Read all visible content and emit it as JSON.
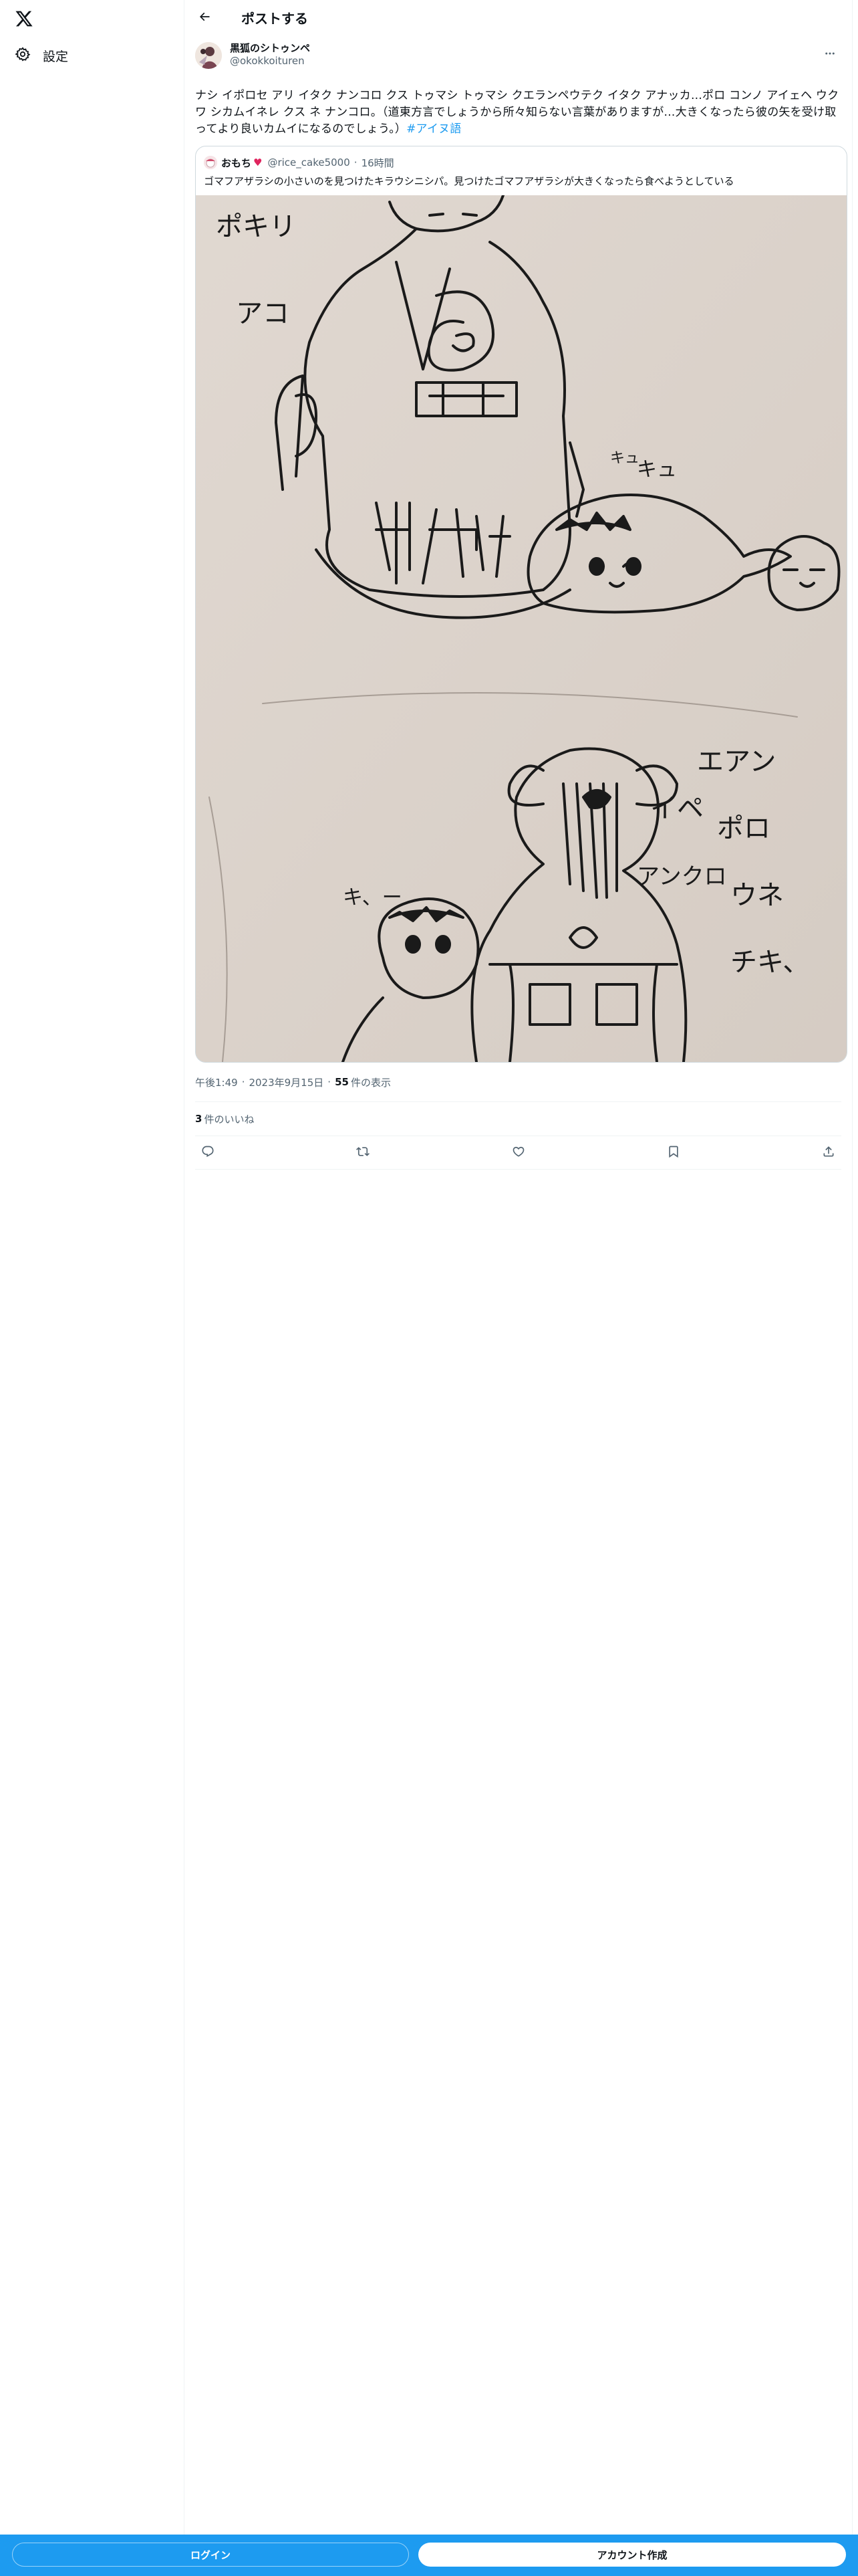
{
  "nav": {
    "logo_icon": "x-logo-icon",
    "settings_label": "設定",
    "settings_icon": "gear-icon"
  },
  "header": {
    "title": "ポストする",
    "back_icon": "arrow-left-icon"
  },
  "post": {
    "author_display_name": "黒狐のシトゥンペ",
    "author_handle": "@okokkoituren",
    "text": "ナシ イポロセ アリ イタク ナンコロ クス トゥマシ トゥマシ クエランペウテク イタク アナッカ…ポロ コンノ アイェヘ ウク ワ シカムイネレ クス ネ ナンコロ。（道東方言でしょうから所々知らない言葉がありますが…大きくなったら彼の矢を受け取ってより良いカムイになるのでしょう。）",
    "hashtag": "#アイヌ語",
    "time": "午後1:49",
    "date": "2023年9月15日",
    "views_count": "55",
    "views_label": "件の表示",
    "likes_count": "3",
    "likes_label": "件のいいね"
  },
  "quoted_post": {
    "display_name": "おもち",
    "heart": "♥",
    "handle": "@rice_cake5000",
    "dot": "·",
    "time": "16時間",
    "text": "ゴマフアザラシの小さいのを見つけたキラウシニシパ。見つけたゴマフアザラシが大きくなったら食べようとしている",
    "media_description_text": {
      "top_left_1": "ポキリ",
      "top_left_2": "アコ",
      "sound_top": "キュ",
      "sound_top_small": "キュ",
      "right_1": "エアン",
      "right_2": "ポロ",
      "right_3": "ウネ",
      "right_4": "チキ、",
      "right_5": "イペ",
      "right_6": "アンクロ",
      "sound_bottom": "キ、ー"
    }
  },
  "meta": {
    "separator": "·"
  },
  "actions": [
    {
      "name": "reply-icon"
    },
    {
      "name": "repost-icon"
    },
    {
      "name": "like-icon"
    },
    {
      "name": "bookmark-icon"
    },
    {
      "name": "share-icon"
    }
  ],
  "bottom_bar": {
    "login_label": "ログイン",
    "signup_label": "アカウント作成"
  },
  "colors": {
    "accent": "#1d9bf0",
    "text_primary": "#0f1419",
    "text_secondary": "#536471",
    "border": "#eff3f4"
  }
}
